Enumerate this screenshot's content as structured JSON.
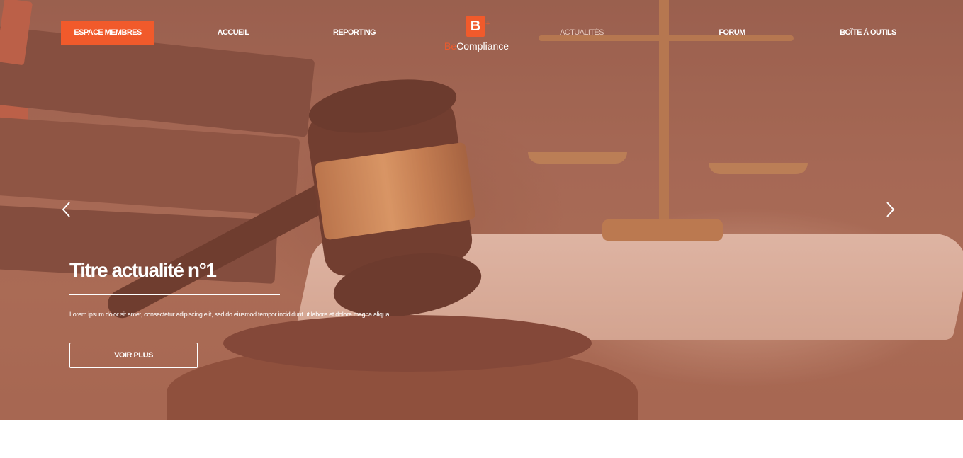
{
  "nav": {
    "members_label": "ESPACE MEMBRES",
    "items": [
      {
        "label": "ACCUEIL"
      },
      {
        "label": "REPORTING"
      },
      {
        "label": "ACTUALITÉS"
      },
      {
        "label": "FORUM"
      },
      {
        "label": "BOÎTE À OUTILS"
      }
    ],
    "active_item": "ACTUALITÉS"
  },
  "logo": {
    "mark": "B",
    "plus": "+",
    "prefix": "Be",
    "suffix": "Compliance"
  },
  "slide": {
    "title": "Titre actualité n°1",
    "excerpt": "Lorem ipsum dolor sit amet, consectetur adipiscing elit, sed do eiusmod tempor incididunt ut labore et dolore magna aliqua ...",
    "button_label": "VOIR PLUS"
  },
  "colors": {
    "accent": "#f15a2b",
    "text_light": "#ffffff",
    "hero_tint": "#c46e54"
  },
  "icons": {
    "prev": "chevron-left-icon",
    "next": "chevron-right-icon"
  }
}
